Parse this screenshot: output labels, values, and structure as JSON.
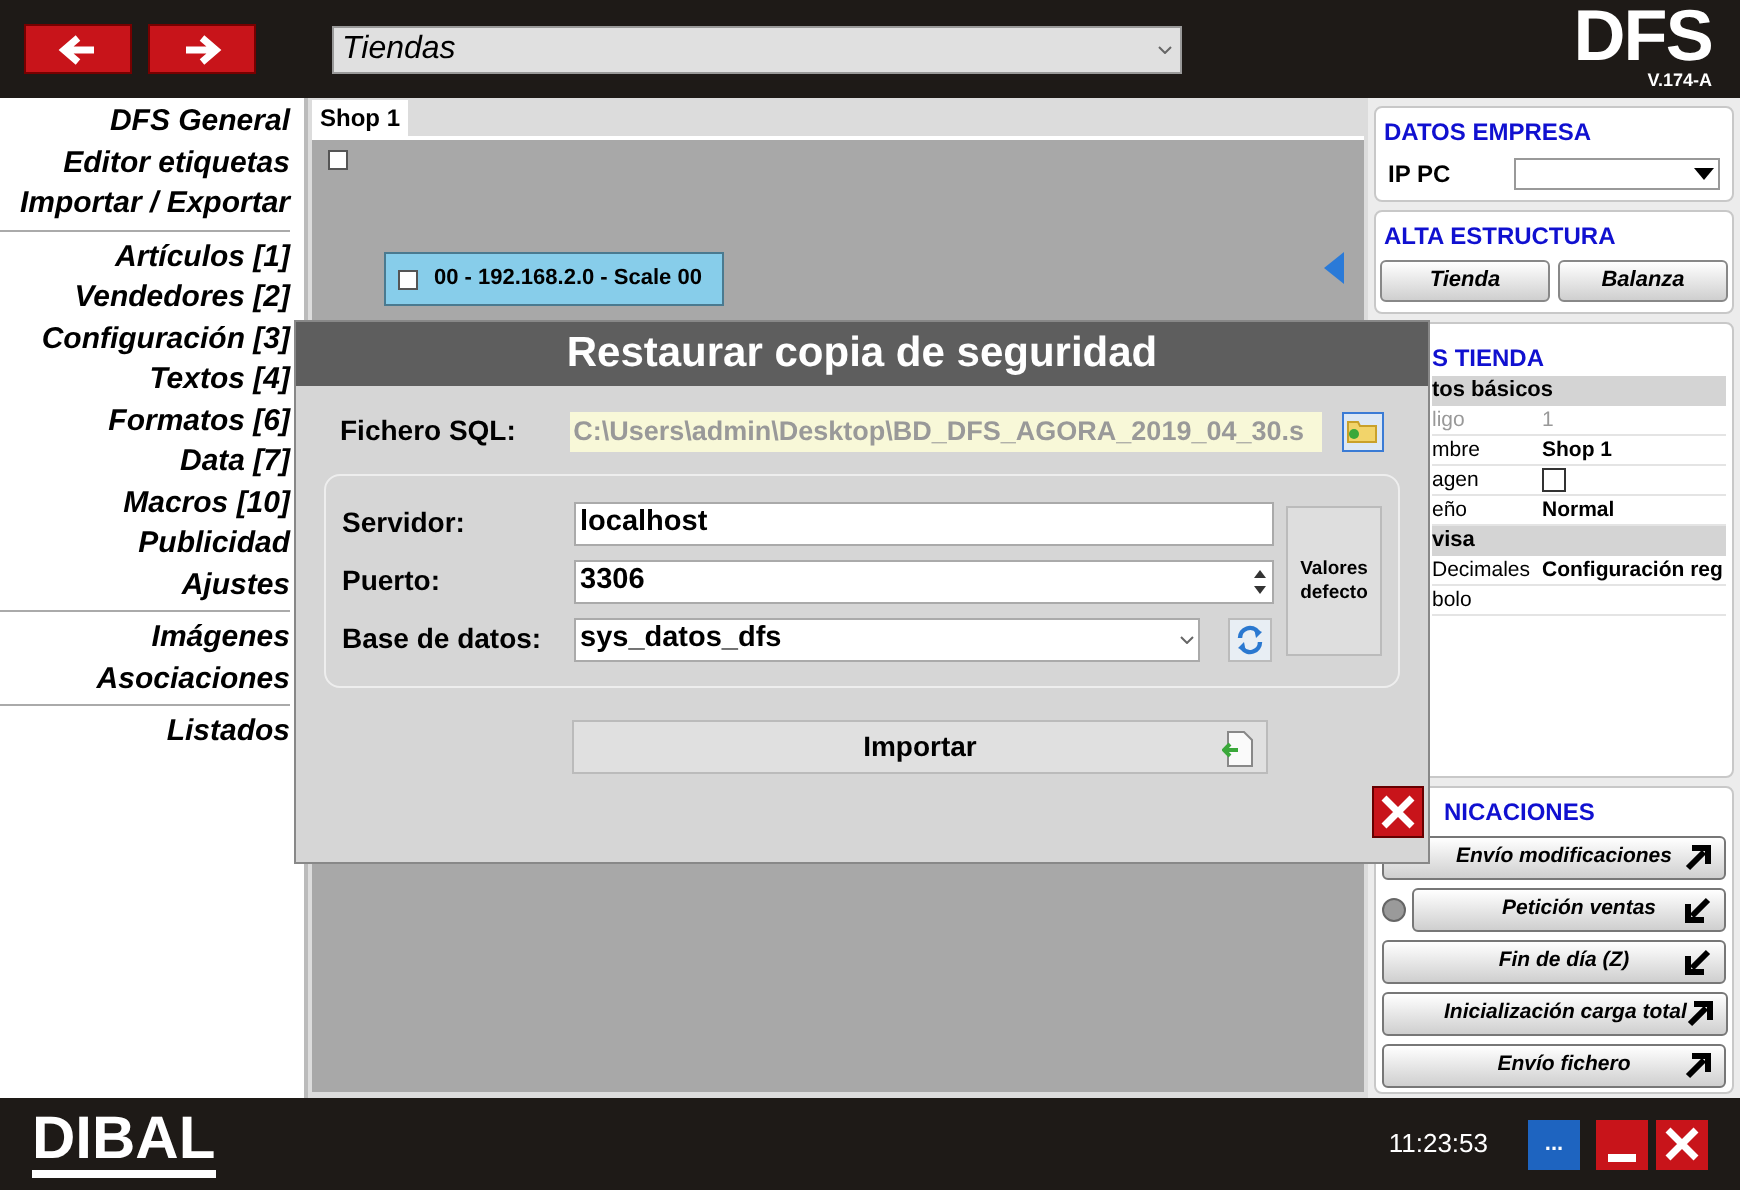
{
  "topbar": {
    "section_select": "Tiendas",
    "logo": "DFS",
    "version": "V.174-A"
  },
  "sidebar": {
    "groups": [
      [
        "DFS General",
        "Editor etiquetas",
        "Importar / Exportar"
      ],
      [
        "Artículos [1]",
        "Vendedores [2]",
        "Configuración [3]",
        "Textos [4]",
        "Formatos [6]",
        "Data [7]",
        "Macros [10]",
        "Publicidad",
        "Ajustes"
      ],
      [
        "Imágenes",
        "Asociaciones"
      ],
      [
        "Listados"
      ]
    ]
  },
  "tabs": [
    {
      "label": "Shop 1",
      "selected": true
    }
  ],
  "canvas": {
    "root_checked": false,
    "node": {
      "label": "00 - 192.168.2.0 - Scale 00",
      "checked": false
    }
  },
  "datos_empresa": {
    "title": "DATOS EMPRESA",
    "label": "IP PC"
  },
  "alta_estructura": {
    "title": "ALTA ESTRUCTURA",
    "buttons": [
      "Tienda",
      "Balanza"
    ]
  },
  "tienda": {
    "title": "S TIENDA",
    "rows": [
      {
        "kind": "section",
        "label": "tos básicos"
      },
      {
        "kind": "text",
        "label": "ligo",
        "value": "1",
        "disabled": true
      },
      {
        "kind": "text",
        "label": "mbre",
        "value": "Shop 1",
        "disabled": false
      },
      {
        "kind": "check",
        "label": "agen",
        "checked": false
      },
      {
        "kind": "text",
        "label": "eño",
        "value": "Normal",
        "disabled": false
      },
      {
        "kind": "section",
        "label": "visa"
      },
      {
        "kind": "text",
        "label": "Decimales",
        "value": "Configuración reg",
        "disabled": false
      },
      {
        "kind": "text",
        "label": "bolo",
        "disabled": false
      }
    ]
  },
  "comunicaciones": {
    "title": "NICACIONES",
    "buttons": [
      {
        "label": "Envío modificaciones",
        "kind": "send",
        "indicator": false
      },
      {
        "label": "Petición ventas",
        "kind": "receive",
        "indicator": true
      },
      {
        "label": "Fin de día (Z)",
        "kind": "receive",
        "indicator": false
      },
      {
        "label": "Inicialización carga total",
        "kind": "send",
        "indicator": false
      },
      {
        "label": "Envío fichero",
        "kind": "send",
        "indicator": false
      }
    ]
  },
  "dialog": {
    "title": "Restaurar copia de seguridad",
    "file_label": "Fichero SQL:",
    "file_value": "C:\\Users\\admin\\Desktop\\BD_DFS_AGORA_2019_04_30.s",
    "server_label": "Servidor:",
    "server_value": "localhost",
    "port_label": "Puerto:",
    "port_value": "3306",
    "db_label": "Base de datos:",
    "db_value": "sys_datos_dfs",
    "defaults_button": "Valores defecto",
    "import_button": "Importar"
  },
  "statusbar": {
    "logo": "DIBAL",
    "time": "11:23:53",
    "more_button": "..."
  }
}
